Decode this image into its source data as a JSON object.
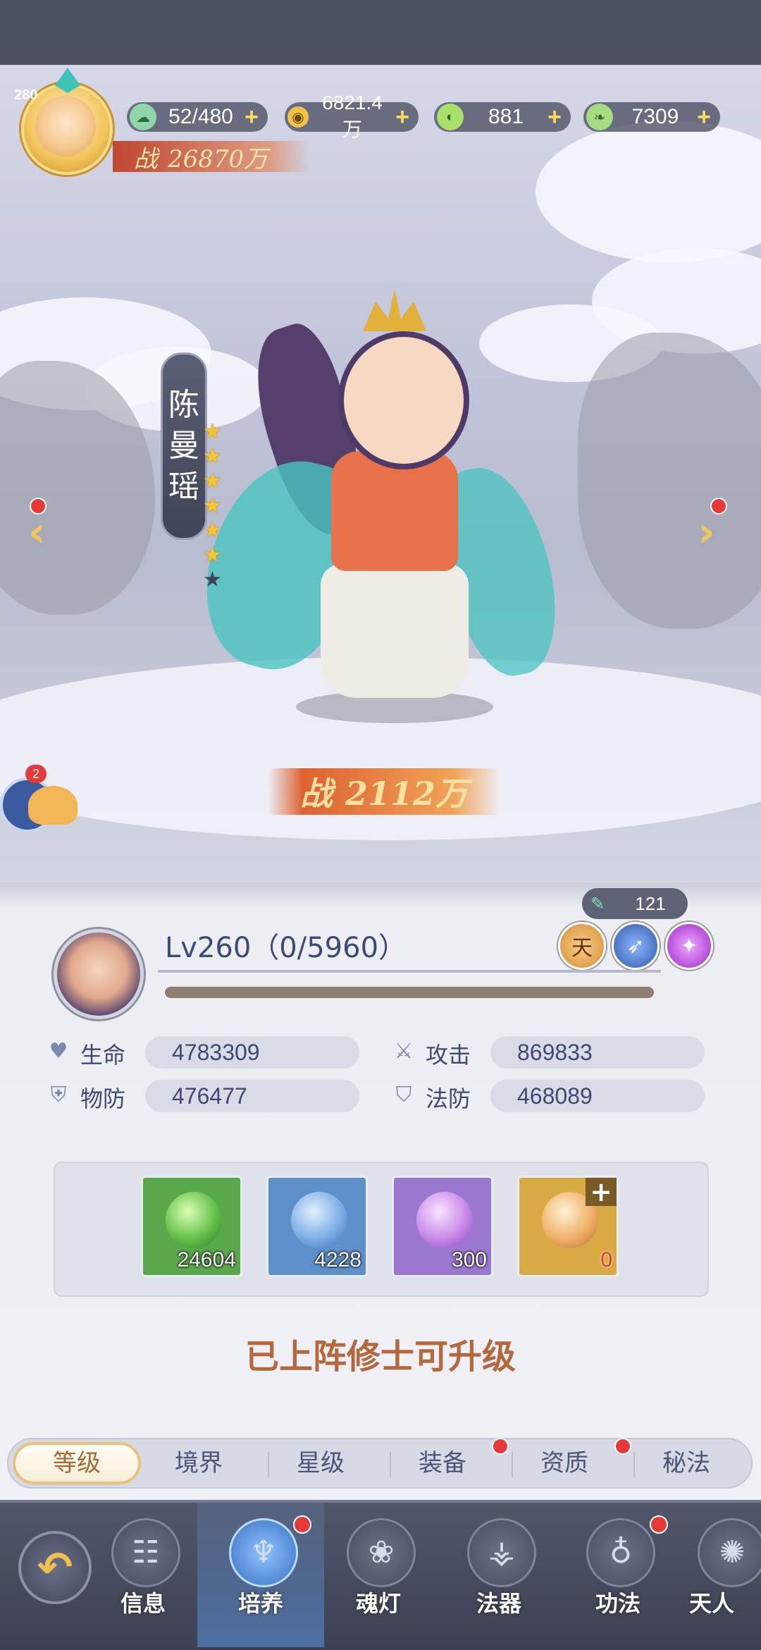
{
  "header": {
    "player_level": "280",
    "resources": [
      {
        "icon": "stamina-icon",
        "value": "52/480"
      },
      {
        "icon": "coin-icon",
        "value": "6821.4万"
      },
      {
        "icon": "jade-icon",
        "value": "881"
      },
      {
        "icon": "leaf-icon",
        "value": "7309"
      }
    ],
    "power_label": "战",
    "power_value": "26870万"
  },
  "character": {
    "name_chars": [
      "陈",
      "曼",
      "瑶"
    ],
    "stars_filled": 6,
    "stars_total": 7,
    "power_label": "战",
    "power_value": "2112万",
    "snail_badge": "2"
  },
  "panel": {
    "scroll_count": "121",
    "level_text": "Lv260（0/5960）",
    "exp_fraction": 0,
    "badges": [
      {
        "name": "tian-badge",
        "text": "天"
      },
      {
        "name": "sword-badge",
        "text": "➶"
      },
      {
        "name": "spirit-badge",
        "text": "✦"
      }
    ],
    "stats": {
      "hp_label": "生命",
      "hp_value": "4783309",
      "atk_label": "攻击",
      "atk_value": "869833",
      "pdef_label": "物防",
      "pdef_value": "476477",
      "mdef_label": "法防",
      "mdef_value": "468089"
    },
    "items": [
      {
        "name": "green-orb",
        "count": "24604",
        "color": "#6bc35a"
      },
      {
        "name": "blue-orb",
        "count": "4228",
        "color": "#6a9bd8"
      },
      {
        "name": "purple-orb",
        "count": "300",
        "color": "#b685e0"
      },
      {
        "name": "golden-orb",
        "count": "0",
        "color": "#e1b650"
      }
    ],
    "hint": "已上阵修士可升级"
  },
  "tabs": [
    {
      "label": "等级",
      "active": true,
      "dot": false
    },
    {
      "label": "境界",
      "active": false,
      "dot": false
    },
    {
      "label": "星级",
      "active": false,
      "dot": false
    },
    {
      "label": "装备",
      "active": false,
      "dot": true
    },
    {
      "label": "资质",
      "active": false,
      "dot": true
    },
    {
      "label": "秘法",
      "active": false,
      "dot": false
    }
  ],
  "nav": [
    {
      "label": "信息",
      "icon": "scroll-icon",
      "active": false,
      "dot": false
    },
    {
      "label": "培养",
      "icon": "cultivate-icon",
      "active": true,
      "dot": true
    },
    {
      "label": "魂灯",
      "icon": "lotus-lamp-icon",
      "active": false,
      "dot": false
    },
    {
      "label": "法器",
      "icon": "artifact-icon",
      "active": false,
      "dot": false
    },
    {
      "label": "功法",
      "icon": "gourd-icon",
      "active": false,
      "dot": true
    },
    {
      "label": "天人",
      "icon": "mandala-icon",
      "active": false,
      "dot": false
    }
  ],
  "colors": {
    "accent": "#f0c75c",
    "panel_bg": "#eef0f5",
    "text": "#3d4a74",
    "hint": "#b4683b",
    "red_dot": "#e63a3a"
  }
}
